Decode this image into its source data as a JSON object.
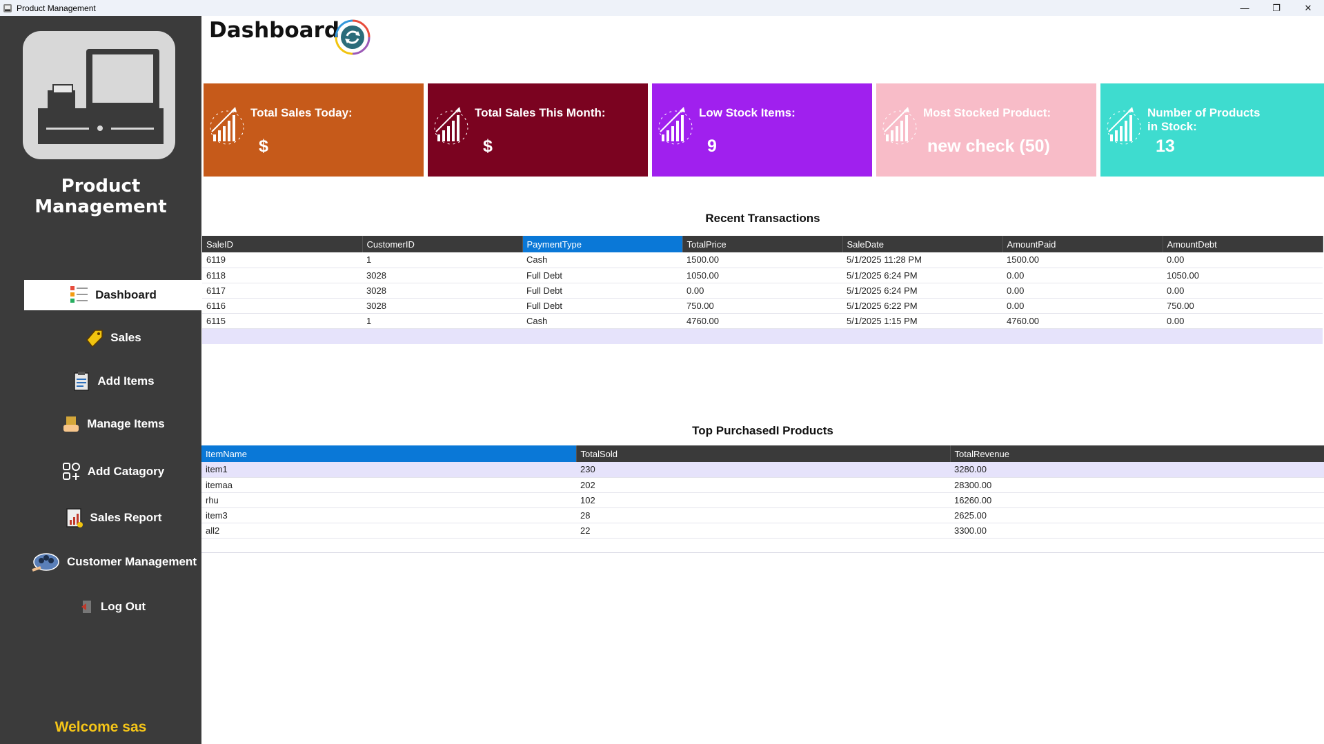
{
  "window": {
    "title": "Product Management"
  },
  "sidebar": {
    "app_name": "Product Management",
    "items": [
      {
        "label": "Dashboard",
        "icon": "dashboard-list-icon",
        "active": true
      },
      {
        "label": "Sales",
        "icon": "sale-tag-icon"
      },
      {
        "label": "Add Items",
        "icon": "clipboard-icon"
      },
      {
        "label": "Manage Items",
        "icon": "box-hand-icon"
      },
      {
        "label": "Add Catagory",
        "icon": "category-grid-icon"
      },
      {
        "label": "Sales Report",
        "icon": "report-chart-icon"
      },
      {
        "label": "Customer Management",
        "icon": "customer-group-icon"
      },
      {
        "label": "Log Out",
        "icon": "logout-door-icon"
      }
    ],
    "welcome": "Welcome sas"
  },
  "header": {
    "title": "Dashboard"
  },
  "cards": [
    {
      "label": "Total Sales Today:",
      "value": "$",
      "color": "#c65a1a"
    },
    {
      "label": "Total Sales This Month:",
      "value": "$",
      "color": "#7b0320"
    },
    {
      "label": "Low Stock Items:",
      "value": "9",
      "color": "#a020ee"
    },
    {
      "label": "Most Stocked Product:",
      "value": "new check (50)",
      "color": "#f8bcc8"
    },
    {
      "label": "Number of Products in Stock:",
      "value": "13",
      "color": "#3edccf"
    }
  ],
  "recent_transactions": {
    "title": "Recent Transactions",
    "columns": [
      "SaleID",
      "CustomerID",
      "PaymentType",
      "TotalPrice",
      "SaleDate",
      "AmountPaid",
      "AmountDebt"
    ],
    "rows": [
      [
        "6119",
        "1",
        "Cash",
        "1500.00",
        "5/1/2025 11:28 PM",
        "1500.00",
        "0.00"
      ],
      [
        "6118",
        "3028",
        "Full Debt",
        "1050.00",
        "5/1/2025 6:24 PM",
        "0.00",
        "1050.00"
      ],
      [
        "6117",
        "3028",
        "Full Debt",
        "0.00",
        "5/1/2025 6:24 PM",
        "0.00",
        "0.00"
      ],
      [
        "6116",
        "3028",
        "Full Debt",
        "750.00",
        "5/1/2025 6:22 PM",
        "0.00",
        "750.00"
      ],
      [
        "6115",
        "1",
        "Cash",
        "4760.00",
        "5/1/2025 1:15 PM",
        "4760.00",
        "0.00"
      ]
    ]
  },
  "top_products": {
    "title": "Top PurchasedI Products",
    "columns": [
      "ItemName",
      "TotalSold",
      "TotalRevenue"
    ],
    "rows": [
      [
        "item1",
        "230",
        "3280.00"
      ],
      [
        "itemaa",
        "202",
        "28300.00"
      ],
      [
        "rhu",
        "102",
        "16260.00"
      ],
      [
        "item3",
        "28",
        "2625.00"
      ],
      [
        "all2",
        "22",
        "3300.00"
      ]
    ]
  }
}
